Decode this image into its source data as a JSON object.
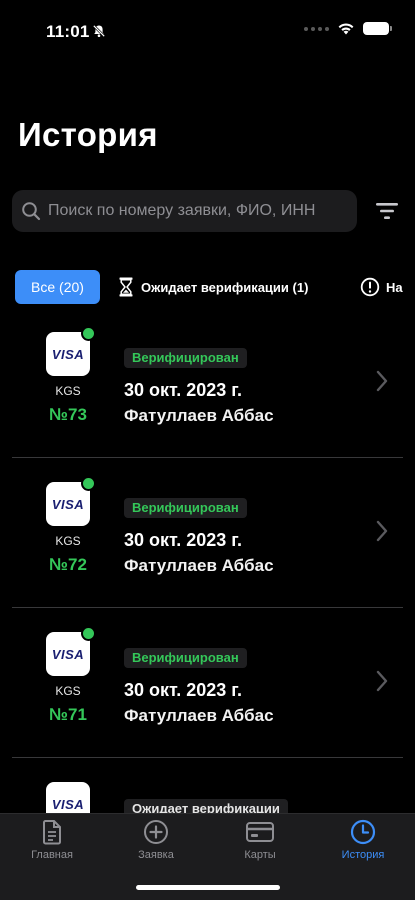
{
  "status_bar": {
    "time": "11:01"
  },
  "header": {
    "title": "История"
  },
  "search": {
    "placeholder": "Поиск по номеру заявки, ФИО, ИНН"
  },
  "filters": {
    "all": "Все (20)",
    "pending": "Ожидает верификации (1)",
    "rejected_partial": "На"
  },
  "colors": {
    "accent": "#3d8ef8",
    "success": "#34c759"
  },
  "applications": [
    {
      "card_logo": "VISA",
      "currency": "KGS",
      "number": "№73",
      "status": "Верифицирован",
      "date": "30 окт. 2023 г.",
      "name": "Фатуллаев Аббас"
    },
    {
      "card_logo": "VISA",
      "currency": "KGS",
      "number": "№72",
      "status": "Верифицирован",
      "date": "30 окт. 2023 г.",
      "name": "Фатуллаев Аббас"
    },
    {
      "card_logo": "VISA",
      "currency": "KGS",
      "number": "№71",
      "status": "Верифицирован",
      "date": "30 окт. 2023 г.",
      "name": "Фатуллаев Аббас"
    },
    {
      "card_logo": "VISA",
      "status": "Ожидает верификации"
    }
  ],
  "tabbar": {
    "items": [
      {
        "label": "Главная",
        "icon": "document-icon"
      },
      {
        "label": "Заявка",
        "icon": "plus-circle-icon"
      },
      {
        "label": "Карты",
        "icon": "card-icon"
      },
      {
        "label": "История",
        "icon": "clock-icon"
      }
    ],
    "active": "История"
  }
}
